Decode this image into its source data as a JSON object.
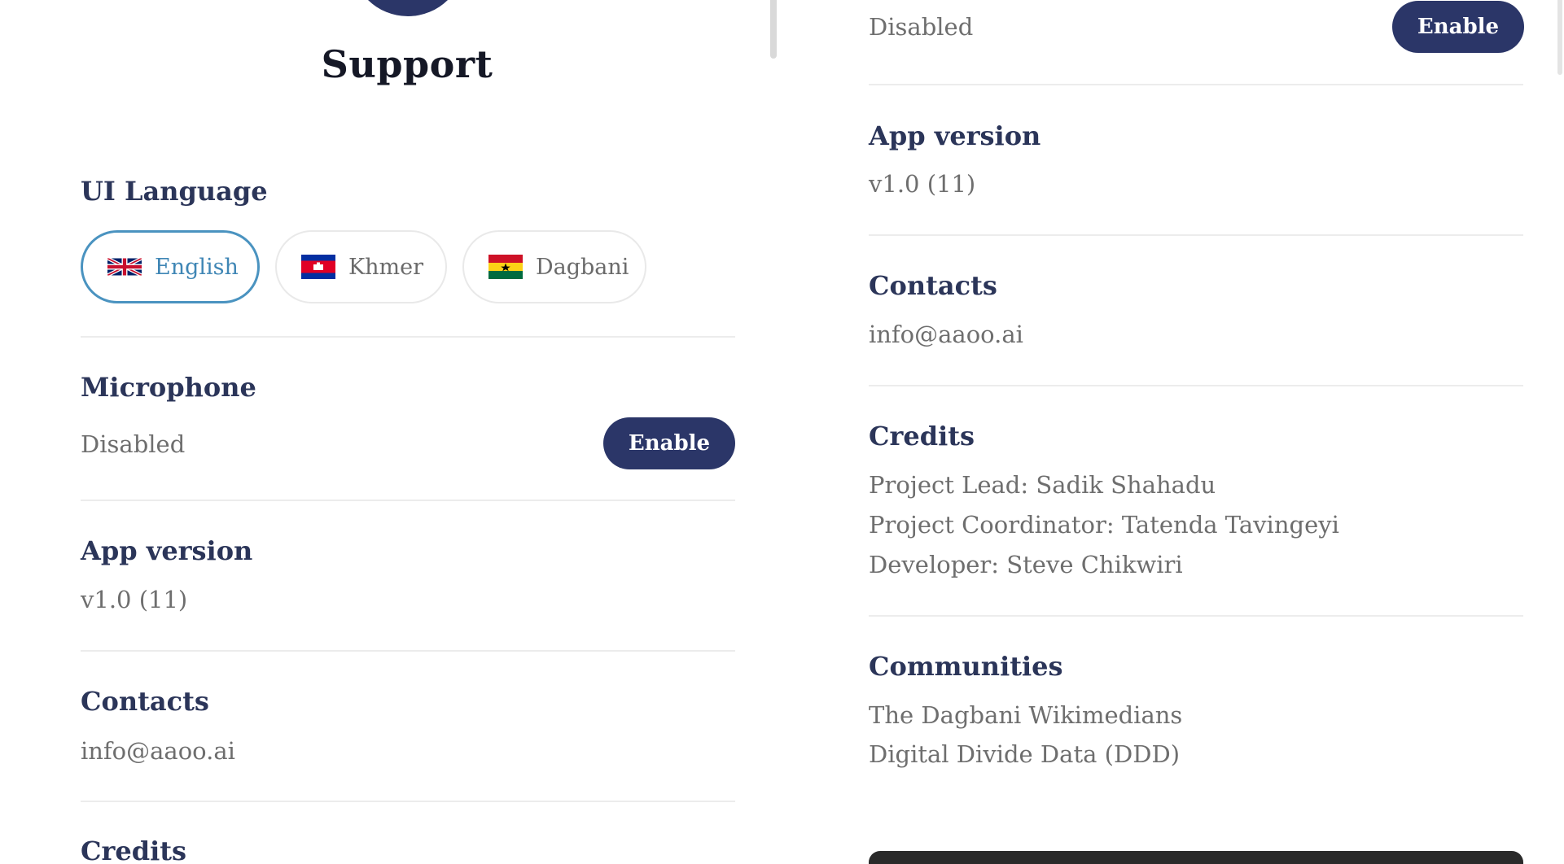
{
  "left": {
    "title": "Support",
    "ui_language": {
      "heading": "UI Language",
      "options": [
        {
          "label": "English",
          "flag": "uk-flag-icon",
          "selected": true
        },
        {
          "label": "Khmer",
          "flag": "cambodia-flag-icon",
          "selected": false
        },
        {
          "label": "Dagbani",
          "flag": "ghana-flag-icon",
          "selected": false
        }
      ]
    },
    "microphone": {
      "heading": "Microphone",
      "status": "Disabled",
      "button_label": "Enable"
    },
    "app_version": {
      "heading": "App version",
      "value": "v1.0 (11)"
    },
    "contacts": {
      "heading": "Contacts",
      "value": "info@aaoo.ai"
    },
    "credits": {
      "heading": "Credits"
    }
  },
  "right": {
    "microphone": {
      "status": "Disabled",
      "button_label": "Enable"
    },
    "app_version": {
      "heading": "App version",
      "value": "v1.0 (11)"
    },
    "contacts": {
      "heading": "Contacts",
      "value": "info@aaoo.ai"
    },
    "credits": {
      "heading": "Credits",
      "lines": [
        "Project Lead: Sadik Shahadu",
        "Project Coordinator: Tatenda Tavingeyi",
        "Developer: Steve Chikwiri"
      ]
    },
    "communities": {
      "heading": "Communities",
      "lines": [
        "The Dagbani Wikimedians",
        "Digital Divide Data (DDD)"
      ]
    }
  },
  "colors": {
    "primary": "#2b3668",
    "heading": "#2b3559",
    "muted_text": "#6e6e6e",
    "selected_accent": "#4a93c0",
    "divider": "#ececec"
  }
}
